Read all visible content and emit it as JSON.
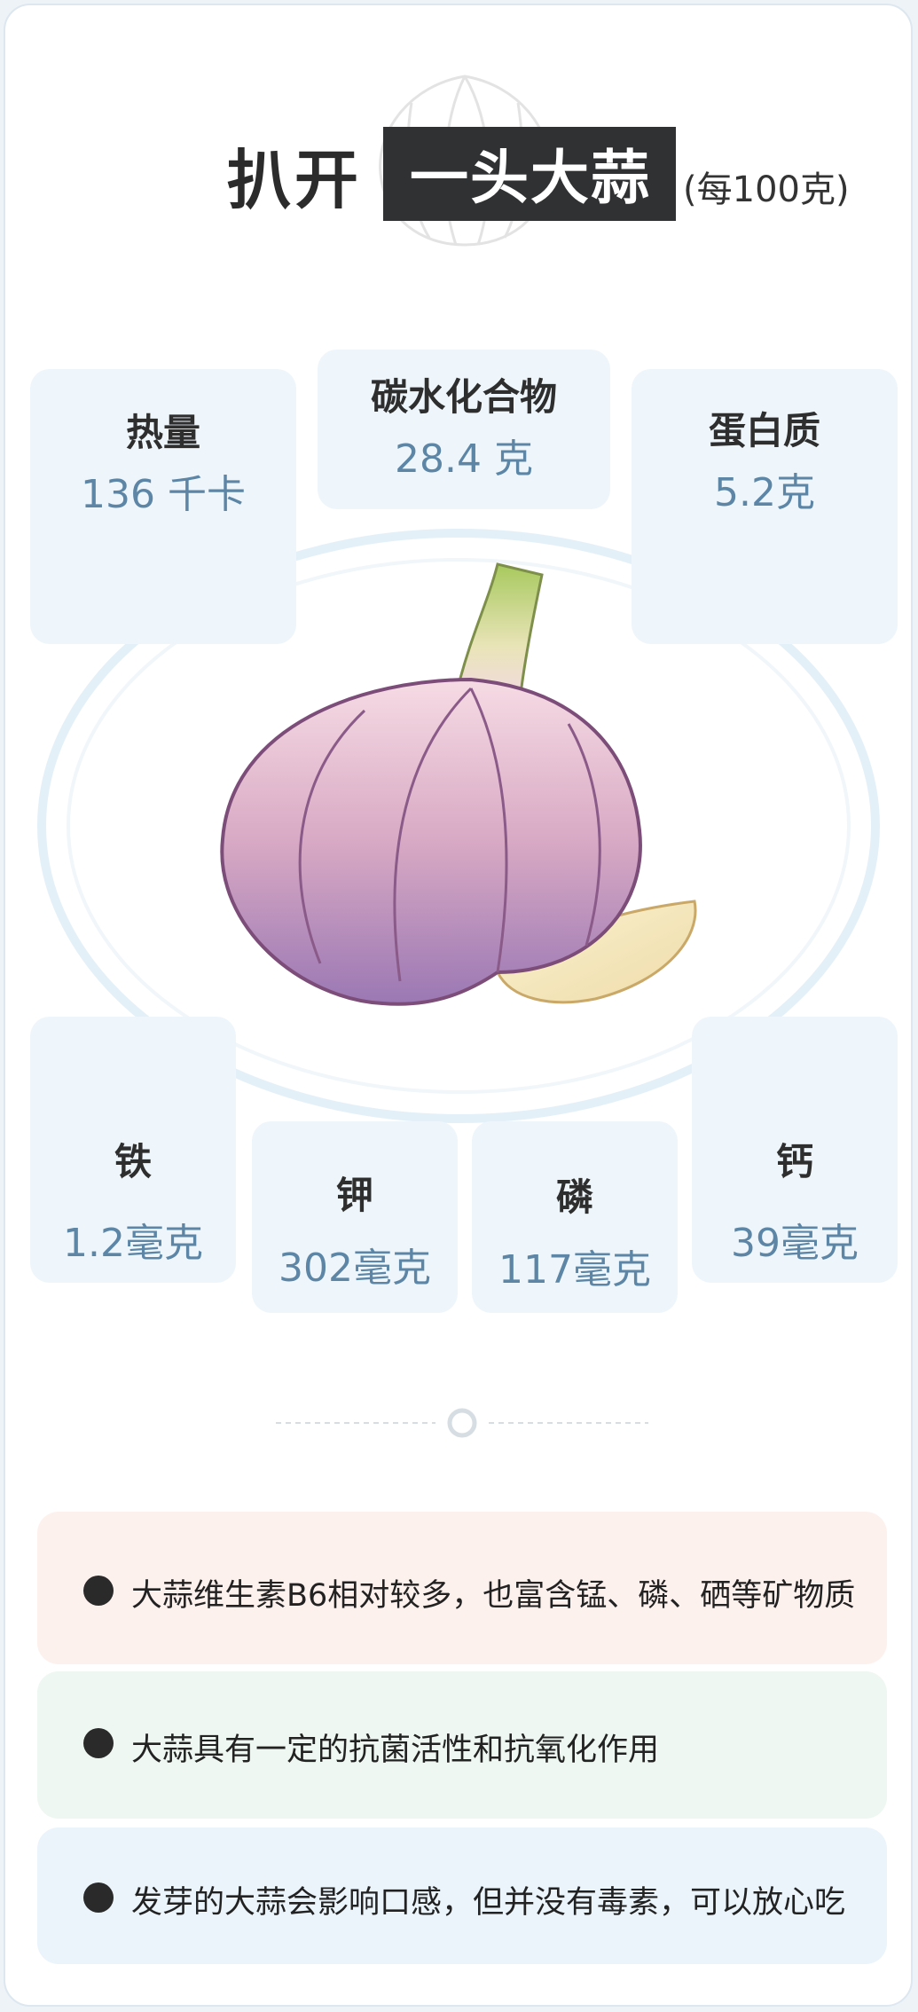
{
  "header": {
    "title_prefix": "扒开",
    "title_highlight": "一头大蒜",
    "title_suffix": "(每100克)"
  },
  "nutrients_top": [
    {
      "name": "热量",
      "value": "136 千卡"
    },
    {
      "name": "碳水化合物",
      "value": "28.4 克"
    },
    {
      "name": "蛋白质",
      "value": "5.2克"
    }
  ],
  "nutrients_bottom": [
    {
      "name": "铁",
      "value": "1.2毫克"
    },
    {
      "name": "钾",
      "value": "302毫克"
    },
    {
      "name": "磷",
      "value": "117毫克"
    },
    {
      "name": "钙",
      "value": "39毫克"
    }
  ],
  "facts": [
    {
      "text": "大蒜维生素B6相对较多，也富含锰、磷、硒等矿物质",
      "bg": "#fdf1ee"
    },
    {
      "text": "大蒜具有一定的抗菌活性和抗氧化作用",
      "bg": "#eef7f1"
    },
    {
      "text": "发芽的大蒜会影响口感，但并没有毒素，可以放心吃",
      "bg": "#ebf4fb"
    }
  ],
  "colors": {
    "value_blue": "#5d86a6",
    "tile_bg": "#eef6fb",
    "title_box": "#2f3133"
  }
}
